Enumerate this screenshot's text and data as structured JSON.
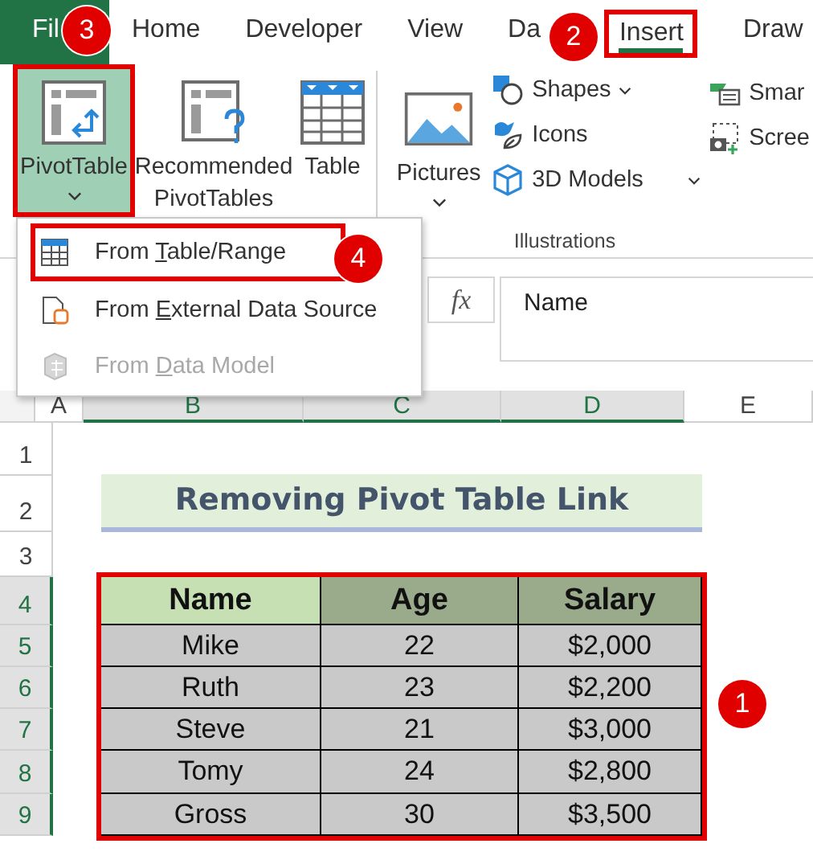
{
  "ribbon_tabs": [
    {
      "label": "Fil",
      "kind": "file",
      "selected": false,
      "highlighted": false
    },
    {
      "label": "Home",
      "kind": "tab",
      "selected": false,
      "highlighted": false
    },
    {
      "label": "Developer",
      "kind": "tab",
      "selected": false,
      "highlighted": false
    },
    {
      "label": "View",
      "kind": "tab",
      "selected": false,
      "highlighted": false
    },
    {
      "label": "Da",
      "kind": "tab",
      "selected": false,
      "highlighted": false
    },
    {
      "label": "Insert",
      "kind": "tab",
      "selected": true,
      "highlighted": true
    },
    {
      "label": "Draw",
      "kind": "tab",
      "selected": false,
      "highlighted": false
    }
  ],
  "tables_group": {
    "buttons": [
      {
        "kind": "pivot",
        "label": "PivotTable",
        "pressed": true,
        "highlighted": true,
        "dropdown": true
      },
      {
        "kind": "recommended",
        "label": "Recommended\nPivotTables",
        "pressed": false,
        "highlighted": false,
        "dropdown": false
      },
      {
        "kind": "table",
        "label": "Table",
        "pressed": false,
        "highlighted": false,
        "dropdown": false
      }
    ]
  },
  "illustrations_group": {
    "label": "Illustrations",
    "large": {
      "label": "Pictures",
      "dropdown": true
    },
    "small": [
      {
        "kind": "shapes",
        "label": "Shapes",
        "dropdown": true
      },
      {
        "kind": "icons",
        "label": "Icons",
        "dropdown": false
      },
      {
        "kind": "models",
        "label": "3D Models",
        "dropdown": true
      }
    ]
  },
  "next_group": {
    "small": [
      {
        "kind": "smartart",
        "label": "Smar"
      },
      {
        "kind": "screenshot",
        "label": "Scree"
      }
    ]
  },
  "pivot_menu": {
    "items": [
      {
        "kind": "table",
        "before": "From ",
        "key": "T",
        "after": "able/Range",
        "disabled": false,
        "highlighted": true
      },
      {
        "kind": "external",
        "before": "From ",
        "key": "E",
        "after": "xternal Data Source",
        "disabled": false,
        "highlighted": false
      },
      {
        "kind": "model",
        "before": "From ",
        "key": "D",
        "after": "ata Model",
        "disabled": true,
        "highlighted": false
      }
    ]
  },
  "formula_bar": {
    "fx": "fx",
    "value": "Name"
  },
  "sheet": {
    "columns": [
      {
        "label": "A",
        "selected": false
      },
      {
        "label": "B",
        "selected": true
      },
      {
        "label": "C",
        "selected": true
      },
      {
        "label": "D",
        "selected": true
      },
      {
        "label": "E",
        "selected": false
      }
    ],
    "rows": [
      {
        "label": "1",
        "selected": false
      },
      {
        "label": "2",
        "selected": false
      },
      {
        "label": "3",
        "selected": false
      },
      {
        "label": "4",
        "selected": true
      },
      {
        "label": "5",
        "selected": true
      },
      {
        "label": "6",
        "selected": true
      },
      {
        "label": "7",
        "selected": true
      },
      {
        "label": "8",
        "selected": true
      },
      {
        "label": "9",
        "selected": true
      }
    ],
    "title": "Removing Pivot Table Link",
    "table": {
      "highlighted": true,
      "header": [
        {
          "text": "Name",
          "color": "#c6e0b4"
        },
        {
          "text": "Age",
          "color": "#9aab8c"
        },
        {
          "text": "Salary",
          "color": "#9aab8c"
        }
      ],
      "rows": [
        [
          "Mike",
          "22",
          "$2,000"
        ],
        [
          "Ruth",
          "23",
          "$2,200"
        ],
        [
          "Steve",
          "21",
          "$3,000"
        ],
        [
          "Tomy",
          "24",
          "$2,800"
        ],
        [
          "Gross",
          "30",
          "$3,500"
        ]
      ]
    }
  },
  "badges": [
    "3",
    "2",
    "4",
    "1"
  ]
}
